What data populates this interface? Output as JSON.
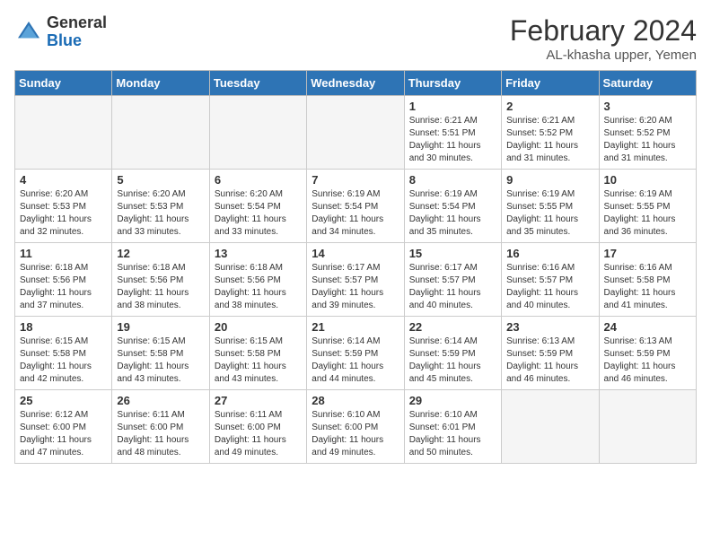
{
  "header": {
    "logo_general": "General",
    "logo_blue": "Blue",
    "month_year": "February 2024",
    "subtitle": "AL-khasha upper, Yemen"
  },
  "days_of_week": [
    "Sunday",
    "Monday",
    "Tuesday",
    "Wednesday",
    "Thursday",
    "Friday",
    "Saturday"
  ],
  "weeks": [
    [
      {
        "day": "",
        "info": ""
      },
      {
        "day": "",
        "info": ""
      },
      {
        "day": "",
        "info": ""
      },
      {
        "day": "",
        "info": ""
      },
      {
        "day": "1",
        "info": "Sunrise: 6:21 AM\nSunset: 5:51 PM\nDaylight: 11 hours and 30 minutes."
      },
      {
        "day": "2",
        "info": "Sunrise: 6:21 AM\nSunset: 5:52 PM\nDaylight: 11 hours and 31 minutes."
      },
      {
        "day": "3",
        "info": "Sunrise: 6:20 AM\nSunset: 5:52 PM\nDaylight: 11 hours and 31 minutes."
      }
    ],
    [
      {
        "day": "4",
        "info": "Sunrise: 6:20 AM\nSunset: 5:53 PM\nDaylight: 11 hours and 32 minutes."
      },
      {
        "day": "5",
        "info": "Sunrise: 6:20 AM\nSunset: 5:53 PM\nDaylight: 11 hours and 33 minutes."
      },
      {
        "day": "6",
        "info": "Sunrise: 6:20 AM\nSunset: 5:54 PM\nDaylight: 11 hours and 33 minutes."
      },
      {
        "day": "7",
        "info": "Sunrise: 6:19 AM\nSunset: 5:54 PM\nDaylight: 11 hours and 34 minutes."
      },
      {
        "day": "8",
        "info": "Sunrise: 6:19 AM\nSunset: 5:54 PM\nDaylight: 11 hours and 35 minutes."
      },
      {
        "day": "9",
        "info": "Sunrise: 6:19 AM\nSunset: 5:55 PM\nDaylight: 11 hours and 35 minutes."
      },
      {
        "day": "10",
        "info": "Sunrise: 6:19 AM\nSunset: 5:55 PM\nDaylight: 11 hours and 36 minutes."
      }
    ],
    [
      {
        "day": "11",
        "info": "Sunrise: 6:18 AM\nSunset: 5:56 PM\nDaylight: 11 hours and 37 minutes."
      },
      {
        "day": "12",
        "info": "Sunrise: 6:18 AM\nSunset: 5:56 PM\nDaylight: 11 hours and 38 minutes."
      },
      {
        "day": "13",
        "info": "Sunrise: 6:18 AM\nSunset: 5:56 PM\nDaylight: 11 hours and 38 minutes."
      },
      {
        "day": "14",
        "info": "Sunrise: 6:17 AM\nSunset: 5:57 PM\nDaylight: 11 hours and 39 minutes."
      },
      {
        "day": "15",
        "info": "Sunrise: 6:17 AM\nSunset: 5:57 PM\nDaylight: 11 hours and 40 minutes."
      },
      {
        "day": "16",
        "info": "Sunrise: 6:16 AM\nSunset: 5:57 PM\nDaylight: 11 hours and 40 minutes."
      },
      {
        "day": "17",
        "info": "Sunrise: 6:16 AM\nSunset: 5:58 PM\nDaylight: 11 hours and 41 minutes."
      }
    ],
    [
      {
        "day": "18",
        "info": "Sunrise: 6:15 AM\nSunset: 5:58 PM\nDaylight: 11 hours and 42 minutes."
      },
      {
        "day": "19",
        "info": "Sunrise: 6:15 AM\nSunset: 5:58 PM\nDaylight: 11 hours and 43 minutes."
      },
      {
        "day": "20",
        "info": "Sunrise: 6:15 AM\nSunset: 5:58 PM\nDaylight: 11 hours and 43 minutes."
      },
      {
        "day": "21",
        "info": "Sunrise: 6:14 AM\nSunset: 5:59 PM\nDaylight: 11 hours and 44 minutes."
      },
      {
        "day": "22",
        "info": "Sunrise: 6:14 AM\nSunset: 5:59 PM\nDaylight: 11 hours and 45 minutes."
      },
      {
        "day": "23",
        "info": "Sunrise: 6:13 AM\nSunset: 5:59 PM\nDaylight: 11 hours and 46 minutes."
      },
      {
        "day": "24",
        "info": "Sunrise: 6:13 AM\nSunset: 5:59 PM\nDaylight: 11 hours and 46 minutes."
      }
    ],
    [
      {
        "day": "25",
        "info": "Sunrise: 6:12 AM\nSunset: 6:00 PM\nDaylight: 11 hours and 47 minutes."
      },
      {
        "day": "26",
        "info": "Sunrise: 6:11 AM\nSunset: 6:00 PM\nDaylight: 11 hours and 48 minutes."
      },
      {
        "day": "27",
        "info": "Sunrise: 6:11 AM\nSunset: 6:00 PM\nDaylight: 11 hours and 49 minutes."
      },
      {
        "day": "28",
        "info": "Sunrise: 6:10 AM\nSunset: 6:00 PM\nDaylight: 11 hours and 49 minutes."
      },
      {
        "day": "29",
        "info": "Sunrise: 6:10 AM\nSunset: 6:01 PM\nDaylight: 11 hours and 50 minutes."
      },
      {
        "day": "",
        "info": ""
      },
      {
        "day": "",
        "info": ""
      }
    ]
  ]
}
